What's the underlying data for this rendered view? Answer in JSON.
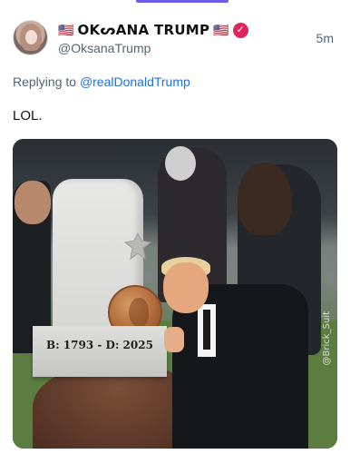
{
  "post": {
    "flag_left": "🇺🇸",
    "display_name": "OKᔕANA TRUMP",
    "flag_right": "🇺🇸",
    "verified_symbol": "✓",
    "handle": "@OksanaTrump",
    "time": "5m",
    "reply_prefix": "Replying to",
    "reply_mention": "@realDonaldTrump",
    "text": "LOL."
  },
  "media": {
    "epitaph": "B: 1793 - D: 2025",
    "watermark": "@Brick_Suit"
  },
  "colors": {
    "accent": "#6c5ce7",
    "mention": "#1d6ff2",
    "verified": "#e0245e",
    "secondary_text": "#536471"
  },
  "icons": {
    "verified": "verified-badge-icon",
    "flag": "us-flag-icon",
    "cross": "tombstone-cross-emblem"
  }
}
